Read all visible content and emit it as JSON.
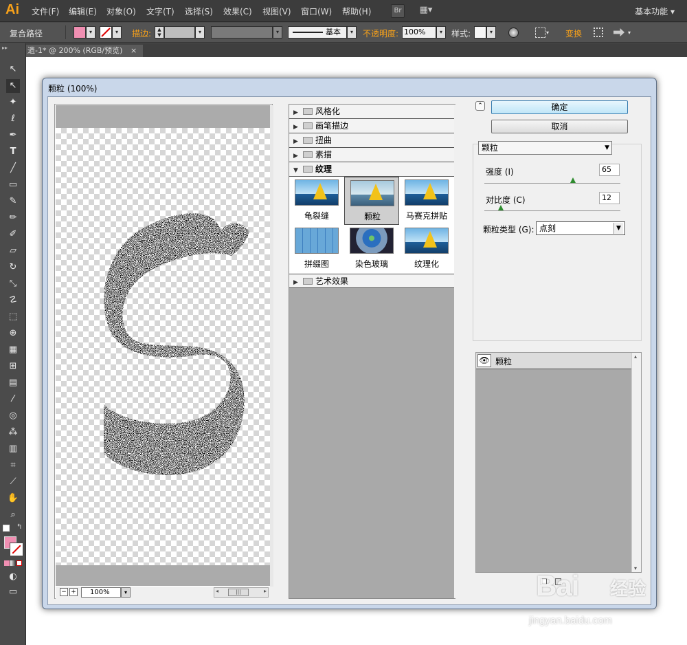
{
  "app": {
    "logo": "Ai",
    "workspace": "基本功能 ▾"
  },
  "menu": [
    "文件(F)",
    "编辑(E)",
    "对象(O)",
    "文字(T)",
    "选择(S)",
    "效果(C)",
    "视图(V)",
    "窗口(W)",
    "帮助(H)"
  ],
  "menu_buttons": {
    "bridge": "Br",
    "arrange": "▦▾"
  },
  "control_bar": {
    "path_label": "复合路径",
    "stroke_label": "描边:",
    "stroke_style": "基本",
    "opacity_label": "不透明度:",
    "opacity_value": "100%",
    "style_label": "样式:",
    "transform_label": "变换"
  },
  "document_tab": {
    "title": "遗-1* @ 200% (RGB/预览)",
    "close": "×"
  },
  "dialog": {
    "title": "颗粒 (100%)",
    "preview": {
      "zoom": "100%",
      "zoom_out": "−",
      "zoom_in": "+"
    },
    "categories": [
      {
        "label": "风格化",
        "expanded": false
      },
      {
        "label": "画笔描边",
        "expanded": false
      },
      {
        "label": "扭曲",
        "expanded": false
      },
      {
        "label": "素描",
        "expanded": false
      },
      {
        "label": "纹理",
        "expanded": true
      },
      {
        "label": "艺术效果",
        "expanded": false
      }
    ],
    "texture_filters": [
      {
        "label": "龟裂缝",
        "selected": false
      },
      {
        "label": "颗粒",
        "selected": true
      },
      {
        "label": "马赛克拼贴",
        "selected": false
      },
      {
        "label": "拼缀图",
        "selected": false
      },
      {
        "label": "染色玻璃",
        "selected": false
      },
      {
        "label": "纹理化",
        "selected": false
      }
    ],
    "ok": "确定",
    "cancel": "取消",
    "filter_select": "颗粒",
    "params": {
      "intensity_label": "强度 (I)",
      "intensity_value": "65",
      "intensity_max": 100,
      "contrast_label": "对比度 (C)",
      "contrast_value": "12",
      "contrast_max": 100,
      "grain_type_label": "颗粒类型 (G):",
      "grain_type_value": "点刻"
    },
    "layer": {
      "eye": "👁",
      "name": "颗粒"
    }
  },
  "watermark": {
    "brand": "Bai",
    "brand_cn": "经验",
    "sub": "jingyan.baidu.com"
  }
}
